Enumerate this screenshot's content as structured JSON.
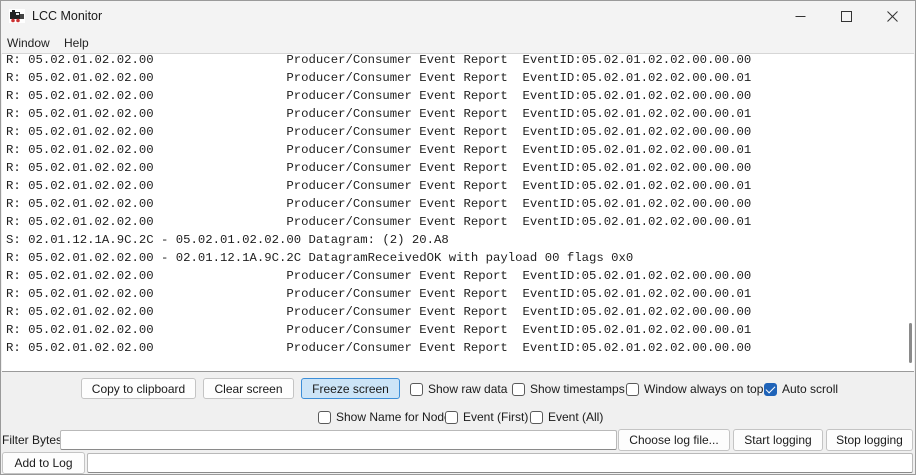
{
  "window": {
    "title": "LCC Monitor"
  },
  "menu": {
    "items": [
      "Window",
      "Help"
    ]
  },
  "log": {
    "lines": [
      "R: 05.02.01.02.02.00                  Producer/Consumer Event Report  EventID:05.02.01.02.02.00.00.00",
      "R: 05.02.01.02.02.00                  Producer/Consumer Event Report  EventID:05.02.01.02.02.00.00.01",
      "R: 05.02.01.02.02.00                  Producer/Consumer Event Report  EventID:05.02.01.02.02.00.00.00",
      "R: 05.02.01.02.02.00                  Producer/Consumer Event Report  EventID:05.02.01.02.02.00.00.01",
      "R: 05.02.01.02.02.00                  Producer/Consumer Event Report  EventID:05.02.01.02.02.00.00.00",
      "R: 05.02.01.02.02.00                  Producer/Consumer Event Report  EventID:05.02.01.02.02.00.00.01",
      "R: 05.02.01.02.02.00                  Producer/Consumer Event Report  EventID:05.02.01.02.02.00.00.00",
      "R: 05.02.01.02.02.00                  Producer/Consumer Event Report  EventID:05.02.01.02.02.00.00.01",
      "R: 05.02.01.02.02.00                  Producer/Consumer Event Report  EventID:05.02.01.02.02.00.00.00",
      "R: 05.02.01.02.02.00                  Producer/Consumer Event Report  EventID:05.02.01.02.02.00.00.01",
      "S: 02.01.12.1A.9C.2C - 05.02.01.02.02.00 Datagram: (2) 20.A8",
      "R: 05.02.01.02.02.00 - 02.01.12.1A.9C.2C DatagramReceivedOK with payload 00 flags 0x0",
      "R: 05.02.01.02.02.00                  Producer/Consumer Event Report  EventID:05.02.01.02.02.00.00.00",
      "R: 05.02.01.02.02.00                  Producer/Consumer Event Report  EventID:05.02.01.02.02.00.00.01",
      "R: 05.02.01.02.02.00                  Producer/Consumer Event Report  EventID:05.02.01.02.02.00.00.00",
      "R: 05.02.01.02.02.00                  Producer/Consumer Event Report  EventID:05.02.01.02.02.00.00.01",
      "R: 05.02.01.02.02.00                  Producer/Consumer Event Report  EventID:05.02.01.02.02.00.00.00"
    ]
  },
  "controls": {
    "copy_label": "Copy to clipboard",
    "clear_label": "Clear screen",
    "freeze_label": "Freeze screen",
    "show_raw_data": {
      "label": "Show raw data",
      "checked": false
    },
    "show_timestamps": {
      "label": "Show timestamps",
      "checked": false
    },
    "window_always_on_top": {
      "label": "Window always on top",
      "checked": false
    },
    "auto_scroll": {
      "label": "Auto scroll",
      "checked": true
    },
    "show_name_for_node": {
      "label": "Show Name for Node",
      "checked": false
    },
    "event_first": {
      "label": "Event (First)",
      "checked": false
    },
    "event_all": {
      "label": "Event (All)",
      "checked": false
    }
  },
  "logging": {
    "filter_label": "Filter Bytes:",
    "filter_value": "",
    "choose_file_label": "Choose log file...",
    "start_label": "Start logging",
    "stop_label": "Stop logging",
    "add_to_log_label": "Add to Log",
    "add_to_log_value": ""
  },
  "colors": {
    "accent": "#1f63b8",
    "active_button": "#cce4f7"
  },
  "icons": {
    "app": "train-icon",
    "minimize": "minimize-icon",
    "maximize": "maximize-icon",
    "close": "close-icon"
  }
}
